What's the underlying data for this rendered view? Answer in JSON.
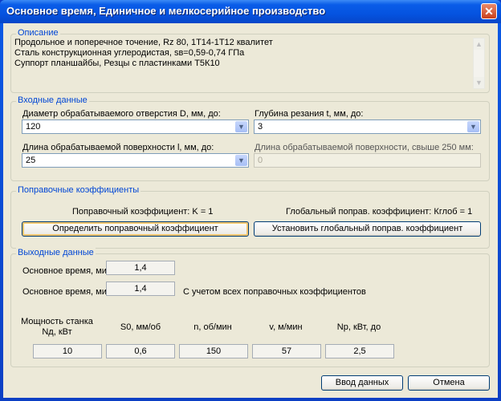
{
  "window": {
    "title": "Основное время, Единичное и мелкосерийное производство",
    "close_icon": "close-icon"
  },
  "description": {
    "label": "Описание",
    "lines": [
      "Продольное и поперечное точение, Rz 80, 1Т14-1Т12 квалитет",
      "Сталь конструкционная углеродистая, sв=0,59-0,74 ГПа",
      "Суппорт планшайбы, Резцы с пластинками Т5К10"
    ]
  },
  "input": {
    "label": "Входные данные",
    "diameter": {
      "label": "Диаметр обрабатываемого отверстия D, мм, до:",
      "value": "120"
    },
    "depth": {
      "label": "Глубина резания t, мм, до:",
      "value": "3"
    },
    "length": {
      "label": "Длина обрабатываемой поверхности l, мм, до:",
      "value": "25"
    },
    "length_over": {
      "label": "Длина обрабатываемой поверхности, свыше 250 мм:",
      "value": "0"
    }
  },
  "correction": {
    "label": "Поправочные коэффициенты",
    "k_text": "Поправочный коэффициент: K = 1",
    "kglob_text": "Глобальный поправ. коэффициент: Кглоб = 1",
    "determine_button": "Определить поправочный коэффициент",
    "set_global_button": "Установить  глобальный поправ. коэффициент"
  },
  "output": {
    "label": "Выходные данные",
    "main_time_label": "Основное время, мин:",
    "main_time": "1,4",
    "main_time2_label": "Основное время, мин:",
    "main_time2": "1,4",
    "main_time2_note": "С учетом всех поправочных коэффициентов",
    "columns": [
      {
        "header": "Мощность станка Nд, кВт",
        "value": "10"
      },
      {
        "header": "S0, мм/об",
        "value": "0,6"
      },
      {
        "header": "n, об/мин",
        "value": "150"
      },
      {
        "header": "v, м/мин",
        "value": "57"
      },
      {
        "header": "Np, кВт, до",
        "value": "2,5"
      }
    ]
  },
  "footer": {
    "enter_button": "Ввод данных",
    "cancel_button": "Отмена"
  }
}
